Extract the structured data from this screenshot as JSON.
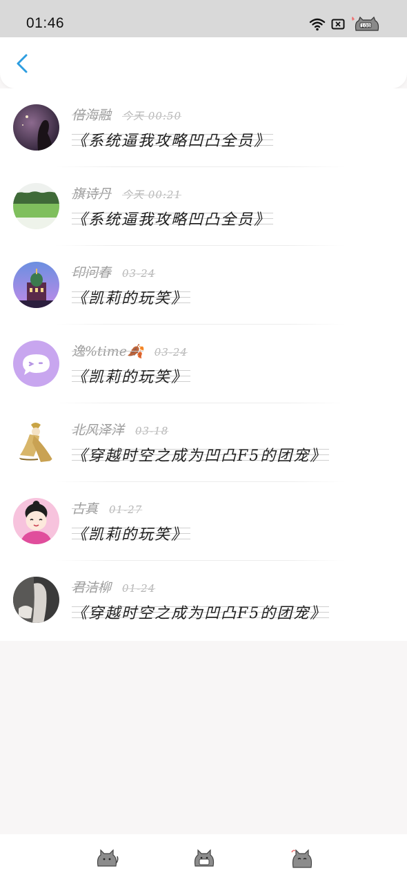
{
  "status_bar": {
    "time": "01:46",
    "icons": [
      "wifi-icon",
      "sim-card-icon",
      "cat-battery-icon"
    ]
  },
  "header": {
    "back_icon": "chevron-left-icon",
    "accent_color": "#2d9de0"
  },
  "conversations": [
    {
      "name": "倍海融",
      "time": "今天 00:50",
      "message": "《系统逼我攻略凹凸全员》",
      "avatar": "night-silhouette"
    },
    {
      "name": "旗诗丹",
      "time": "今天 00:21",
      "message": "《系统逼我攻略凹凸全员》",
      "avatar": "green-field"
    },
    {
      "name": "印问春",
      "time": "03-24",
      "message": "《凯莉的玩笑》",
      "avatar": "cathedral"
    },
    {
      "name": "逸%time🍂",
      "time": "03-24",
      "message": "《凯莉的玩笑》",
      "avatar": "chat-bubble"
    },
    {
      "name": "北风泽洋",
      "time": "03-18",
      "message": "《穿越时空之成为凹凸F5的团宠》",
      "avatar": "anime-girl"
    },
    {
      "name": "古真",
      "time": "01-27",
      "message": "《凯莉的玩笑》",
      "avatar": "cartoon-girl"
    },
    {
      "name": "君洁柳",
      "time": "01-24",
      "message": "《穿越时空之成为凹凸F5的团宠》",
      "avatar": "dark-photo"
    }
  ],
  "bottom_nav": {
    "items": [
      "cat-home-icon",
      "cat-chat-icon",
      "cat-profile-icon"
    ]
  }
}
